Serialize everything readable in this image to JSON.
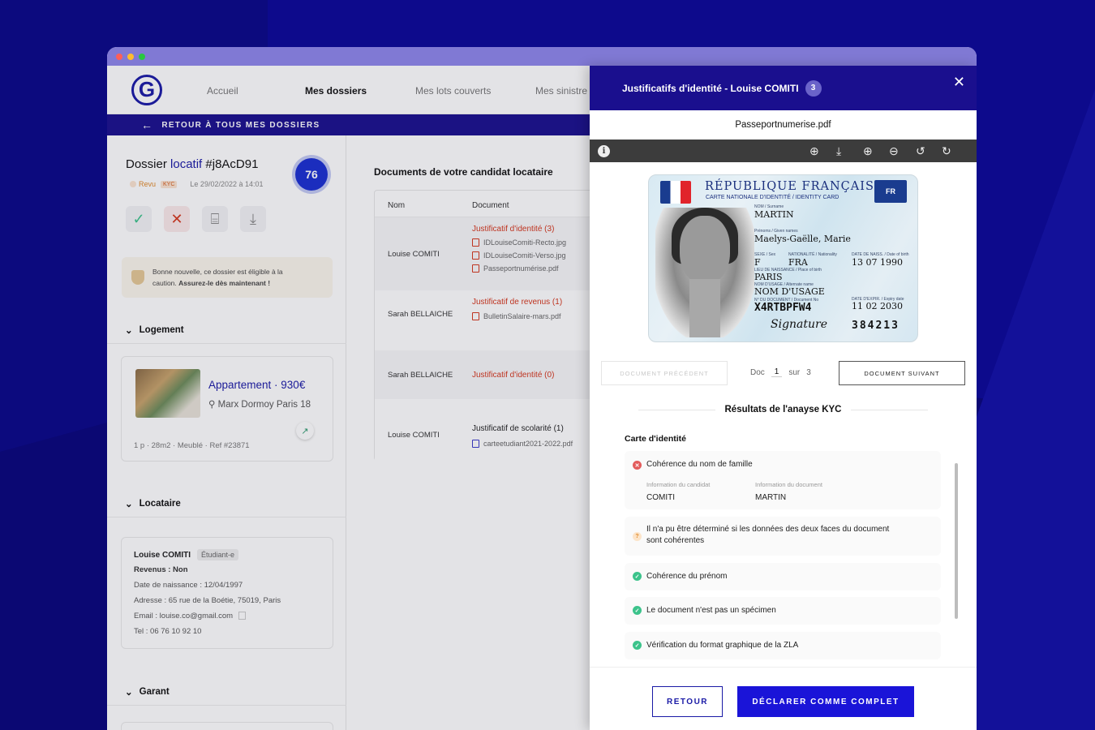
{
  "colors": {
    "brand": "#1a0f8e",
    "accent": "#1a14d8",
    "error": "#d5361c",
    "ok": "#3cc38b"
  },
  "nav": {
    "logo": "G",
    "items": [
      "Accueil",
      "Mes dossiers",
      "Mes lots couverts",
      "Mes sinistre"
    ],
    "back": "RETOUR À TOUS MES DOSSIERS"
  },
  "dossier": {
    "title_prefix": "Dossier",
    "title_kw": "locatif",
    "title_id": "#j8AcD91",
    "score": "76",
    "status": "Revu",
    "kyc_badge": "KYC",
    "date": "Le 29/02/2022 à 14:01",
    "notice_1": "Bonne nouvelle, ce dossier est éligible à la",
    "notice_2_plain": "caution.",
    "notice_2_bold": "Assurez-le dès maintenant !"
  },
  "logement": {
    "heading": "Logement",
    "title": "Appartement · 930€",
    "address": "Marx Dormoy Paris 18",
    "meta": "1 p · 28m2 · Meublé · Ref #23871"
  },
  "locataire": {
    "heading": "Locataire",
    "name": "Louise COMITI",
    "tag": "Étudiant-e",
    "revenus": "Revenus : Non",
    "naissance": "Date de naissance : 12/04/1997",
    "adresse": "Adresse : 65 rue de la Boétie, 75019, Paris",
    "email": "Email : louise.co@gmail.com",
    "tel": "Tel : 06 76 10 92 10"
  },
  "garant": {
    "heading": "Garant"
  },
  "documents": {
    "heading": "Documents de votre candidat locataire",
    "col_nom": "Nom",
    "col_doc": "Document",
    "rows": [
      {
        "name": "Louise COMITI",
        "type": "Justificatif d'identité (3)",
        "files": [
          "IDLouiseComiti-Recto.jpg",
          "IDLouiseComiti-Verso.jpg",
          "Passeportnumérise.pdf"
        ]
      },
      {
        "name": "Sarah BELLAICHE",
        "type": "Justificatif de revenus (1)",
        "files": [
          "BulletinSalaire-mars.pdf"
        ]
      },
      {
        "name": "Sarah BELLAICHE",
        "type": "Justificatif d'identité (0)",
        "files": []
      },
      {
        "name": "Louise COMITI",
        "type": "Justificatif de scolarité (1)",
        "files": [
          "carteetudiant2021-2022.pdf"
        ]
      }
    ]
  },
  "panel": {
    "title": "Justificatifs d'identité - Louise COMITI",
    "count": "3",
    "filename": "Passeportnumerise.pdf",
    "card": {
      "country": "RÉPUBLIQUE FRANÇAISE",
      "subtitle": "CARTE NATIONALE D'IDENTITÉ / IDENTITY CARD",
      "eu": "FR",
      "lbl_nom": "NOM / Surname",
      "nom": "MARTIN",
      "lbl_prenoms": "Prénoms / Given names",
      "prenoms": "Maelys-Gaëlle, Marie",
      "lbl_sexe": "SEXE / Sex",
      "sexe": "F",
      "lbl_nat": "NATIONALITÉ / Nationality",
      "nationalite": "FRA",
      "lbl_naiss": "DATE DE NAISS. / Date of birth",
      "naissance": "13 07 1990",
      "lbl_lieu": "LIEU DE NAISSANCE / Place of birth",
      "lieu": "PARIS",
      "lbl_usage": "NOM D'USAGE / Alternate name",
      "usage": "NOM D'USAGE",
      "lbl_numdoc": "N° DU DOCUMENT / Document No",
      "numero": "X4RTBPFW4",
      "lbl_expiry": "DATE D'EXPIR. / Expiry date",
      "expiration": "11 02 2030",
      "code": "384213",
      "signature": "Signature"
    },
    "pager": {
      "prev": "DOCUMENT PRÉCÉDENT",
      "doc": "Doc",
      "current": "1",
      "sur": "sur",
      "total": "3",
      "next": "DOCUMENT SUIVANT"
    },
    "kyc_heading": "Résultats de l'anayse KYC",
    "kyc_section": "Carte d'identité",
    "checks": [
      {
        "status": "error",
        "text": "Cohérence du nom de famille"
      },
      {
        "status": "warn",
        "text": "Il n'a pu être déterminé si les données des deux faces du document sont cohérentes"
      },
      {
        "status": "ok",
        "text": "Cohérence du prénom"
      },
      {
        "status": "ok",
        "text": "Le document n'est pas un spécimen"
      },
      {
        "status": "ok",
        "text": "Vérification du format graphique de la ZLA"
      }
    ],
    "info_candidat_lbl": "Information du candidat",
    "info_candidat": "COMITI",
    "info_doc_lbl": "Information du document",
    "info_doc": "MARTIN",
    "btn_retour": "RETOUR",
    "btn_complet": "DÉCLARER COMME COMPLET"
  }
}
